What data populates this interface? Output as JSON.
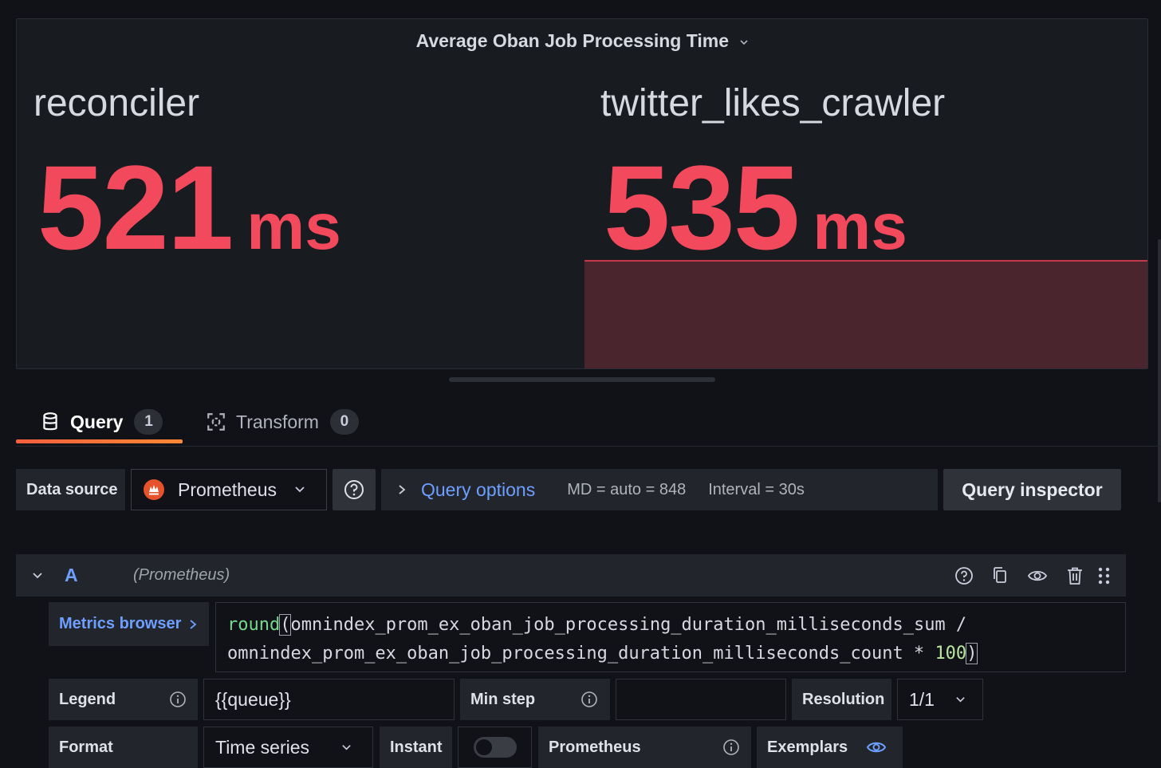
{
  "panel": {
    "title": "Average Oban Job Processing Time",
    "stats": [
      {
        "name": "reconciler",
        "value": "521",
        "unit": "ms"
      },
      {
        "name": "twitter_likes_crawler",
        "value": "535",
        "unit": "ms"
      }
    ],
    "value_color": "#f2495c"
  },
  "tabs": [
    {
      "label": "Query",
      "count": "1",
      "icon": "database-icon",
      "active": true
    },
    {
      "label": "Transform",
      "count": "0",
      "icon": "transform-icon",
      "active": false
    }
  ],
  "toolbar": {
    "datasource_label": "Data source",
    "datasource_value": "Prometheus",
    "query_options_label": "Query options",
    "md": "MD = auto = 848",
    "interval": "Interval = 30s",
    "query_inspector": "Query inspector"
  },
  "query": {
    "ref": "A",
    "datasource": "(Prometheus)",
    "metrics_browser": "Metrics browser",
    "expr_fn": "round",
    "expr_line1": "omnindex_prom_ex_oban_job_processing_duration_milliseconds_sum /",
    "expr_line2": "omnindex_prom_ex_oban_job_processing_duration_milliseconds_count * ",
    "expr_num": "100",
    "legend_label": "Legend",
    "legend_value": "{{queue}}",
    "min_step_label": "Min step",
    "min_step_value": "",
    "resolution_label": "Resolution",
    "resolution_value": "1/1",
    "format_label": "Format",
    "format_value": "Time series",
    "instant_label": "Instant",
    "instant_on": false,
    "prometheus_label": "Prometheus",
    "exemplars_label": "Exemplars"
  }
}
